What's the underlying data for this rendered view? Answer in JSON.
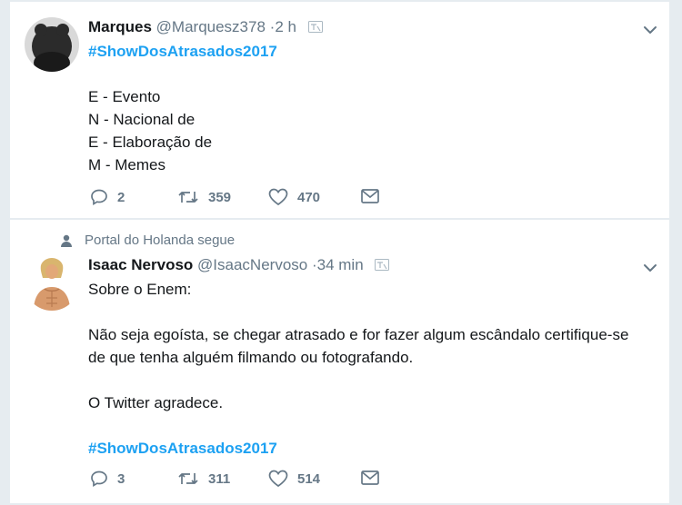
{
  "tweets": [
    {
      "name": "Marques",
      "handle": "@Marquesz378",
      "time": "·2 h",
      "hashtag": "#ShowDosAtrasados2017",
      "lines": [
        "E - Evento",
        "N - Nacional de",
        "E - Elaboração de",
        "M - Memes"
      ],
      "replies": "2",
      "retweets": "359",
      "likes": "470"
    },
    {
      "social_context": "Portal do Holanda segue",
      "name": "Isaac Nervoso",
      "handle": "@IsaacNervoso",
      "time": "·34 min",
      "intro": "Sobre o Enem:",
      "body_line1": "Não seja egoísta, se chegar atrasado e for fazer algum escândalo certifique-se",
      "body_line2": "de que tenha alguém filmando ou fotografando.",
      "closing": "O Twitter agradece.",
      "hashtag": "#ShowDosAtrasados2017",
      "replies": "3",
      "retweets": "311",
      "likes": "514"
    }
  ],
  "colors": {
    "accent": "#1da1f2",
    "secondary_text": "#657786",
    "background": "#e6ecf0"
  }
}
